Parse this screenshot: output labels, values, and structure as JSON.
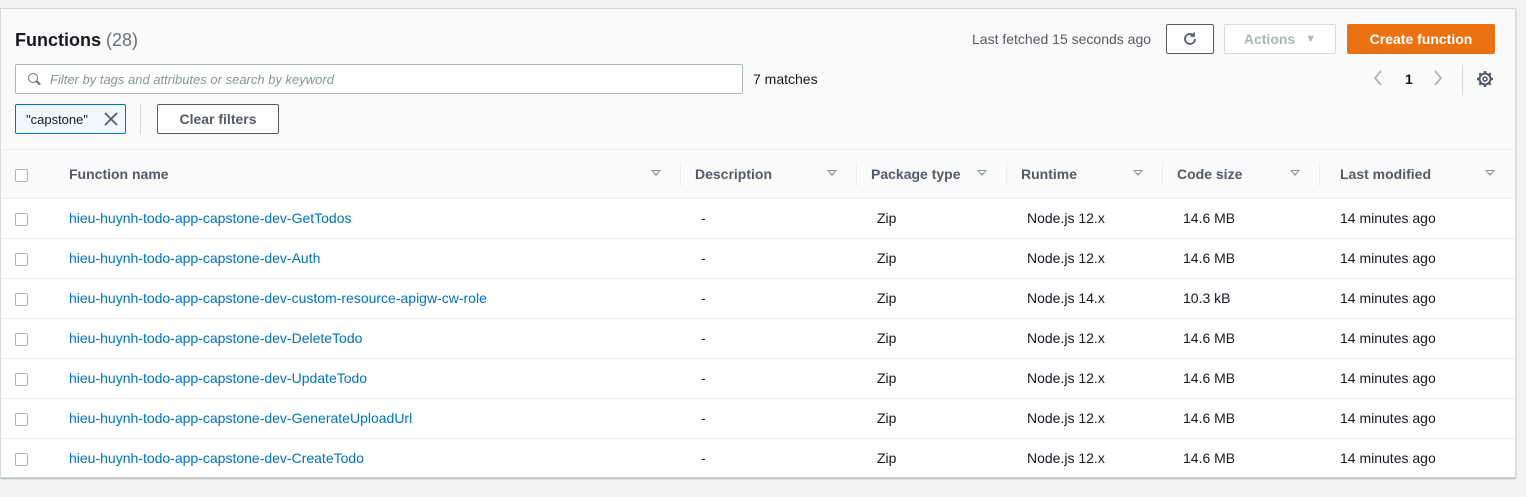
{
  "header": {
    "title": "Functions",
    "count": "(28)",
    "last_fetched": "Last fetched 15 seconds ago",
    "actions_label": "Actions",
    "create_label": "Create function"
  },
  "search": {
    "placeholder": "Filter by tags and attributes or search by keyword",
    "matches": "7 matches"
  },
  "pagination": {
    "page": "1"
  },
  "filters": {
    "token": "\"capstone\"",
    "clear_label": "Clear filters"
  },
  "table": {
    "columns": [
      "Function name",
      "Description",
      "Package type",
      "Runtime",
      "Code size",
      "Last modified"
    ],
    "rows": [
      {
        "name": "hieu-huynh-todo-app-capstone-dev-GetTodos",
        "description": "-",
        "package": "Zip",
        "runtime": "Node.js 12.x",
        "size": "14.6 MB",
        "modified": "14 minutes ago"
      },
      {
        "name": "hieu-huynh-todo-app-capstone-dev-Auth",
        "description": "-",
        "package": "Zip",
        "runtime": "Node.js 12.x",
        "size": "14.6 MB",
        "modified": "14 minutes ago"
      },
      {
        "name": "hieu-huynh-todo-app-capstone-dev-custom-resource-apigw-cw-role",
        "description": "-",
        "package": "Zip",
        "runtime": "Node.js 14.x",
        "size": "10.3 kB",
        "modified": "14 minutes ago"
      },
      {
        "name": "hieu-huynh-todo-app-capstone-dev-DeleteTodo",
        "description": "-",
        "package": "Zip",
        "runtime": "Node.js 12.x",
        "size": "14.6 MB",
        "modified": "14 minutes ago"
      },
      {
        "name": "hieu-huynh-todo-app-capstone-dev-UpdateTodo",
        "description": "-",
        "package": "Zip",
        "runtime": "Node.js 12.x",
        "size": "14.6 MB",
        "modified": "14 minutes ago"
      },
      {
        "name": "hieu-huynh-todo-app-capstone-dev-GenerateUploadUrl",
        "description": "-",
        "package": "Zip",
        "runtime": "Node.js 12.x",
        "size": "14.6 MB",
        "modified": "14 minutes ago"
      },
      {
        "name": "hieu-huynh-todo-app-capstone-dev-CreateTodo",
        "description": "-",
        "package": "Zip",
        "runtime": "Node.js 12.x",
        "size": "14.6 MB",
        "modified": "14 minutes ago"
      }
    ]
  },
  "colors": {
    "accent": "#ec7211",
    "link": "#0073bb"
  }
}
